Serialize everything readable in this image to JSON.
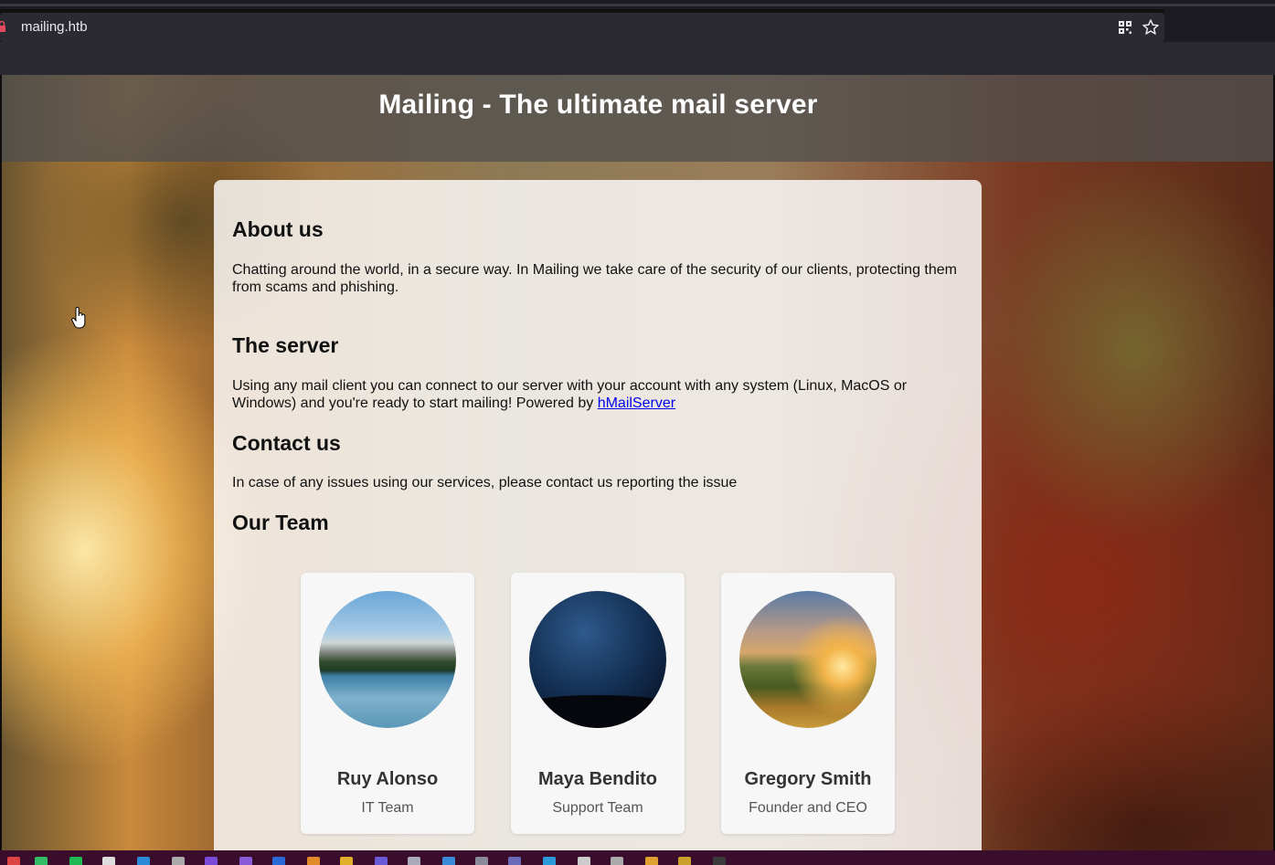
{
  "browser": {
    "url": "mailing.htb",
    "icons": [
      "lock-icon",
      "qr-code-icon",
      "bookmark-star-icon"
    ]
  },
  "page": {
    "title": "Mailing - The ultimate mail server",
    "sections": {
      "about": {
        "heading": "About us",
        "text": "Chatting around the world, in a secure way. In Mailing we take care of the security of our clients, protecting them from scams and phishing."
      },
      "server": {
        "heading": "The server",
        "text_before_link": "Using any mail client you can connect to our server with your account with any system (Linux, MacOS or Windows) and you're ready to start mailing! Powered by ",
        "link_text": "hMailServer"
      },
      "contact": {
        "heading": "Contact us",
        "text": "In case of any issues using our services, please contact us reporting the issue"
      },
      "team": {
        "heading": "Our Team",
        "members": [
          {
            "name": "Ruy Alonso",
            "role": "IT Team",
            "photo": "mountain-lake"
          },
          {
            "name": "Maya Bendito",
            "role": "Support Team",
            "photo": "night-sky"
          },
          {
            "name": "Gregory Smith",
            "role": "Founder and CEO",
            "photo": "sunset-valley"
          }
        ]
      }
    }
  },
  "taskbar": {
    "app_icons": [
      "chrome-icon",
      "spotify-icon",
      "pycharm-icon",
      "vscode-icon",
      "app-icon",
      "app-icon",
      "visual-studio-icon",
      "app-icon",
      "app-icon",
      "app-icon",
      "app-icon",
      "app-icon",
      "app-icon",
      "app-icon",
      "app-icon",
      "app-icon",
      "app-icon",
      "app-icon",
      "app-icon",
      "folder-icon",
      "app-icon",
      "app-icon"
    ],
    "colors": {
      "background": "#3b0d2c"
    }
  },
  "colors": {
    "header_overlay": "#505050",
    "link": "#0000ee",
    "card": "#ffffff"
  }
}
